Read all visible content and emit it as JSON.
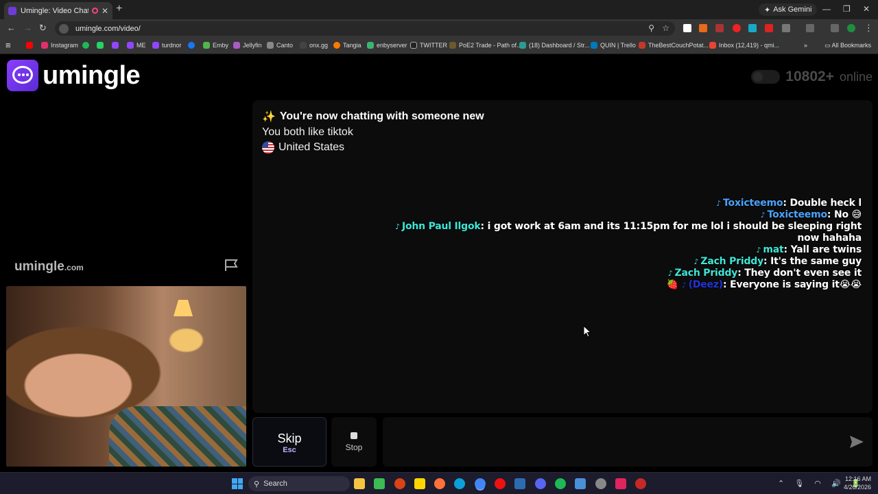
{
  "browser": {
    "tab_title": "Umingle: Video Chat with S",
    "new_tab": "+",
    "ask_gemini": "Ask Gemini",
    "url": "umingle.com/video/",
    "bookmarks": [
      {
        "label": "Instagram",
        "color": "#e1306c"
      },
      {
        "label": "",
        "color": "#1db954"
      },
      {
        "label": "",
        "color": "#25d366"
      },
      {
        "label": "ME",
        "color": "#9146ff"
      },
      {
        "label": "turdnor",
        "color": "#9146ff"
      },
      {
        "label": "Emby",
        "color": "#52b54b"
      },
      {
        "label": "Jellyfin",
        "color": "#aa5cc3"
      },
      {
        "label": "Canto",
        "color": "#888888"
      },
      {
        "label": "onx.gg",
        "color": "#444444"
      },
      {
        "label": "Tangia",
        "color": "#ff7a00"
      },
      {
        "label": "enbyserver",
        "color": "#3cb371"
      },
      {
        "label": "TWITTER",
        "color": "#222222"
      },
      {
        "label": "PoE2 Trade - Path of...",
        "color": "#6b5a2a"
      },
      {
        "label": "(18) Dashboard / Str...",
        "color": "#2a9d8f"
      },
      {
        "label": "QUIN | Trello",
        "color": "#0079bf"
      },
      {
        "label": "TheBestCouchPotat...",
        "color": "#c0392b"
      },
      {
        "label": "Inbox (12,419) - qmi...",
        "color": "#ea4335"
      }
    ],
    "all_bookmarks": "All Bookmarks"
  },
  "header": {
    "logo_text": "umingle",
    "online_count": "10802+",
    "online_label": "online"
  },
  "sidebar": {
    "watermark": "umingle",
    "watermark_suffix": ".com"
  },
  "chat": {
    "system": {
      "line1_emoji": "✨",
      "line1": "You're now chatting with someone new",
      "line2": "You both like tiktok",
      "line3": "United States"
    },
    "overlay_messages": [
      {
        "user": "Toxicteemo",
        "text": "Double heck l",
        "color": "#4aa3ff"
      },
      {
        "user": "Toxicteemo",
        "text": "No 😅",
        "color": "#4aa3ff"
      },
      {
        "user": "John Paul Ilgok",
        "text": "i got work at 6am and its 11:15pm for me lol i should be sleeping right now hahaha",
        "color": "#3ee6d6"
      },
      {
        "user": "mat",
        "text": "Yall are twins",
        "color": "#3ee6d6"
      },
      {
        "user": "Zach Priddy",
        "text": "It's the same guy",
        "color": "#3ee6d6"
      },
      {
        "user": "Zach Priddy",
        "text": "They don't even see it",
        "color": "#3ee6d6"
      },
      {
        "user": "(Deez)",
        "text": "Everyone is saying it😭😭",
        "color": "#2233dd",
        "badge": "🍓"
      }
    ]
  },
  "controls": {
    "skip_label": "Skip",
    "skip_hint": "Esc",
    "stop_label": "Stop",
    "input_placeholder": ""
  },
  "taskbar": {
    "search_label": "Search",
    "time": "12:16 AM",
    "date": "4/26/2026"
  }
}
